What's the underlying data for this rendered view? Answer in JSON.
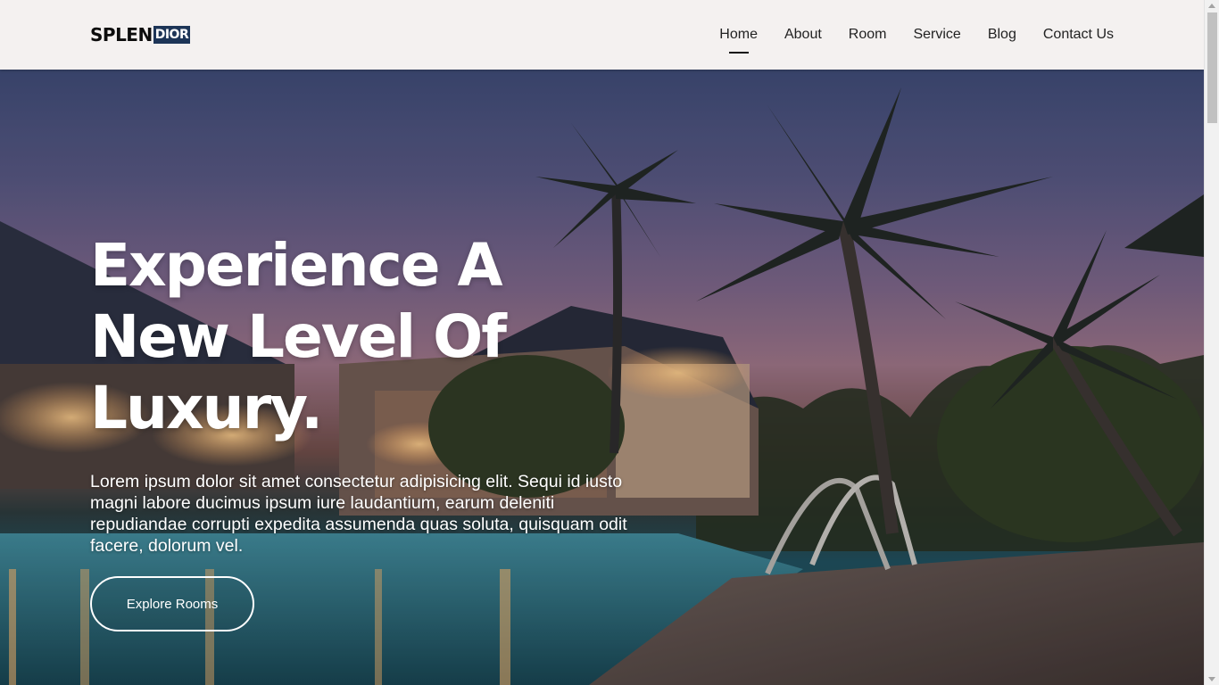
{
  "brand": {
    "part1": "SPLEN",
    "part2": "DIOR",
    "accent": "#1d3557"
  },
  "nav": {
    "items": [
      {
        "label": "Home",
        "active": true
      },
      {
        "label": "About",
        "active": false
      },
      {
        "label": "Room",
        "active": false
      },
      {
        "label": "Service",
        "active": false
      },
      {
        "label": "Blog",
        "active": false
      },
      {
        "label": "Contact Us",
        "active": false
      }
    ]
  },
  "hero": {
    "title_lines": [
      "Experience A",
      "New Level Of",
      "Luxury."
    ],
    "description": "Lorem ipsum dolor sit amet consectetur adipisicing elit. Sequi id iusto magni labore ducimus ipsum iure laudantium, earum deleniti repudiandae corrupti expedita assumenda quas soluta, quisquam odit facere, dolorum vel.",
    "button_label": "Explore Rooms",
    "background_image": "resort-pool-palm-trees-dusk"
  }
}
